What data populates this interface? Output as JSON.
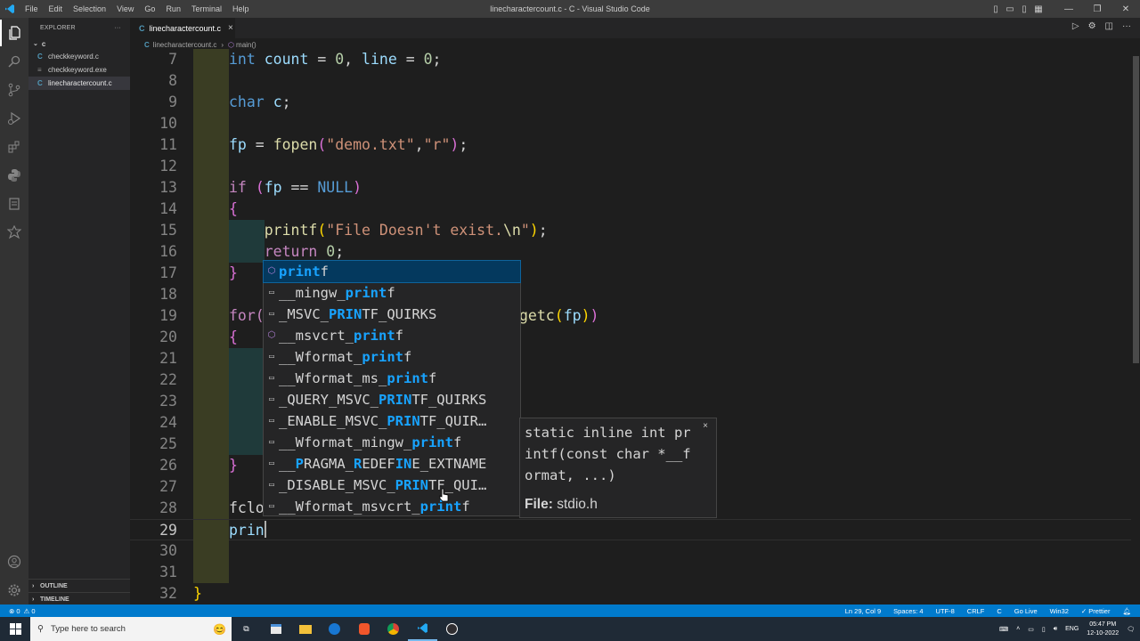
{
  "titlebar": {
    "menu": [
      "File",
      "Edit",
      "Selection",
      "View",
      "Go",
      "Run",
      "Terminal",
      "Help"
    ],
    "title": "linecharactercount.c - C - Visual Studio Code"
  },
  "sidebar": {
    "header": "EXPLORER",
    "more": "···",
    "folder": "c",
    "files": [
      {
        "name": "checkkeyword.c",
        "icon": "C"
      },
      {
        "name": "checkkeyword.exe",
        "icon": "≡"
      },
      {
        "name": "linecharactercount.c",
        "icon": "C"
      }
    ],
    "outline": "OUTLINE",
    "timeline": "TIMELINE"
  },
  "tab": {
    "label": "linecharactercount.c",
    "icon": "C"
  },
  "breadcrumb": {
    "file": "linecharactercount.c",
    "symbol": "main()"
  },
  "code": {
    "line_numbers": [
      "7",
      "8",
      "9",
      "10",
      "11",
      "12",
      "13",
      "14",
      "15",
      "16",
      "17",
      "18",
      "19",
      "20",
      "21",
      "22",
      "23",
      "24",
      "25",
      "26",
      "27",
      "28",
      "29",
      "30",
      "31",
      "32"
    ],
    "visible_fragments": {
      "for_start": "for(",
      "for_end": "getc(fp))",
      "fclose_prefix": "fclo",
      "typed": "prin"
    }
  },
  "suggest": {
    "items": [
      {
        "pre": "",
        "match": "print",
        "post": "f",
        "kind": "function"
      },
      {
        "pre": "__mingw_",
        "match": "print",
        "post": "f",
        "kind": "function"
      },
      {
        "pre": "_MSVC_",
        "match": "PRIN",
        "post": "TF_QUIRKS",
        "kind": "constant"
      },
      {
        "pre": "__msvcrt_",
        "match": "print",
        "post": "f",
        "kind": "function"
      },
      {
        "pre": "__Wformat_",
        "match": "print",
        "post": "f",
        "kind": "constant"
      },
      {
        "pre": "__Wformat_ms_",
        "match": "print",
        "post": "f",
        "kind": "constant"
      },
      {
        "pre": "_QUERY_MSVC_",
        "match": "PRIN",
        "post": "TF_QUIRKS",
        "kind": "constant"
      },
      {
        "pre": "_ENABLE_MSVC_",
        "match": "PRIN",
        "post": "TF_QUIR…",
        "kind": "constant"
      },
      {
        "pre": "__Wformat_mingw_",
        "match": "print",
        "post": "f",
        "kind": "constant"
      },
      {
        "pre": "__PRAGMA_REDEFINE_EXTNAME",
        "match": "",
        "post": "",
        "kind": "constant"
      },
      {
        "pre": "_DISABLE_MSVC_",
        "match": "PRIN",
        "post": "TF_QUI…",
        "kind": "constant"
      },
      {
        "pre": "__Wformat_msvcrt_",
        "match": "print",
        "post": "f",
        "kind": "constant"
      }
    ]
  },
  "details": {
    "signature": "static inline int pr\nintf(const char *__f\normat, ...)",
    "file_label": "File:",
    "file_value": "stdio.h",
    "close": "×"
  },
  "statusbar": {
    "left": [
      "⊗ 0",
      "⚠ 0"
    ],
    "right": [
      "Ln 29, Col 9",
      "Spaces: 4",
      "UTF-8",
      "CRLF",
      "C",
      "Go Live",
      "Win32",
      "✓ Prettier"
    ]
  },
  "taskbar": {
    "search_placeholder": "Type here to search",
    "lang": "ENG",
    "time": "05:47 PM",
    "date": "12-10-2022"
  },
  "colors": {
    "accent": "#007acc",
    "selection": "#04395e",
    "match": "#18a3ff"
  }
}
